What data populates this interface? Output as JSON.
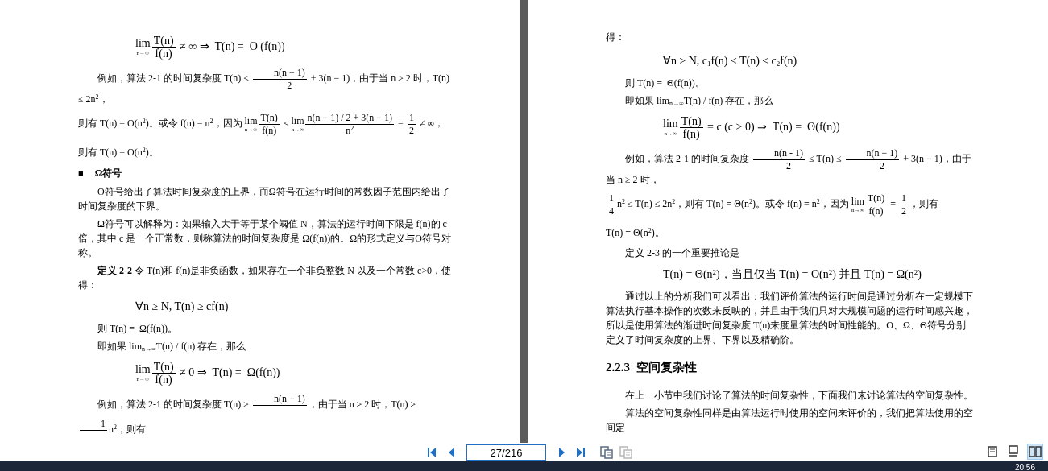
{
  "pages": [
    {
      "blocks": [
        {
          "kind": "display",
          "segments": [
            {
              "kind": "lim",
              "sub": "n→∞"
            },
            {
              "kind": "frac",
              "num": "T(n)",
              "den": "f(n)"
            },
            {
              "kind": "text",
              "text": " ≠ ∞ ⇒  T(n) =  Ο (f(n))"
            }
          ]
        },
        {
          "kind": "para",
          "segments": [
            {
              "kind": "text",
              "text": "例如，算法 2-1 的时间复杂度 T(n) ≤ "
            },
            {
              "kind": "frac",
              "num": "n(n − 1)",
              "den": "2"
            },
            {
              "kind": "text",
              "text": " + 3(n − 1)，由于当 n ≥ 2 时，T(n) ≤ 2n$^{2}$，"
            }
          ]
        },
        {
          "kind": "text",
          "segments": [
            {
              "kind": "text",
              "text": "则有 T(n) = O(n$^{2}$)。或令 f(n) = n$^{2}$，因为 "
            },
            {
              "kind": "lim",
              "sub": "n→∞"
            },
            {
              "kind": "frac",
              "num": "T(n)",
              "den": "f(n)"
            },
            {
              "kind": "text",
              "text": " ≤ "
            },
            {
              "kind": "lim",
              "sub": "n→∞"
            },
            {
              "kind": "frac",
              "num": "n(n − 1) / 2 + 3(n − 1)",
              "den": "n$^{2}$"
            },
            {
              "kind": "text",
              "text": " = "
            },
            {
              "kind": "frac",
              "num": "1",
              "den": "2"
            },
            {
              "kind": "text",
              "text": " ≠ ∞，"
            }
          ]
        },
        {
          "kind": "text",
          "segments": [
            {
              "kind": "text",
              "text": "则有 T(n) = O(n$^{2}$)。"
            }
          ]
        },
        {
          "kind": "heading",
          "bullet": "■",
          "title": "Ω符号"
        },
        {
          "kind": "para",
          "segments": [
            {
              "kind": "text",
              "text": "Ο符号给出了算法时间复杂度的上界，而Ω符号在运行时间的常数因子范围内给出了时间复杂度的下界。"
            }
          ]
        },
        {
          "kind": "para",
          "segments": [
            {
              "kind": "text",
              "text": "Ω符号可以解释为：如果输入大于等于某个阈值 N，算法的运行时间下限是 f(n)的 c 倍，其中 c 是一个正常数，则称算法的时间复杂度是 Ω(f(n))的。Ω的形式定义与Ο符号对称。"
            }
          ]
        },
        {
          "kind": "para",
          "segments": [
            {
              "kind": "text",
              "text": "**定义 2-2** 令 T(n)和 f(n)是非负函数，如果存在一个非负整数 N 以及一个常数 c>0，使得："
            }
          ]
        },
        {
          "kind": "display",
          "segments": [
            {
              "kind": "text",
              "text": "∀n ≥ N, T(n) ≥ cf(n)"
            }
          ]
        },
        {
          "kind": "para",
          "segments": [
            {
              "kind": "text",
              "text": "则 T(n) =  Ω(f(n))。"
            }
          ]
        },
        {
          "kind": "para",
          "segments": [
            {
              "kind": "text",
              "text": "即如果 lim$_{n→∞}$T(n) / f(n) 存在，那么"
            }
          ]
        },
        {
          "kind": "display",
          "segments": [
            {
              "kind": "lim",
              "sub": "n→∞"
            },
            {
              "kind": "frac",
              "num": "T(n)",
              "den": "f(n)"
            },
            {
              "kind": "text",
              "text": " ≠ 0 ⇒  T(n) =  Ω(f(n))"
            }
          ]
        },
        {
          "kind": "para",
          "segments": [
            {
              "kind": "text",
              "text": "例如，算法 2-1 的时间复杂度 T(n) ≥ "
            },
            {
              "kind": "frac",
              "num": "n(n − 1)"
            },
            {
              "kind": "text",
              "text": "，由于当 n ≥ 2 时，T(n) ≥ "
            },
            {
              "kind": "frac",
              "num": "1"
            },
            {
              "kind": "text",
              "text": "n$^{2}$，则有"
            }
          ]
        }
      ]
    },
    {
      "blocks": [
        {
          "kind": "text",
          "segments": [
            {
              "kind": "text",
              "text": "得："
            }
          ]
        },
        {
          "kind": "display",
          "segments": [
            {
              "kind": "text",
              "text": "∀n ≥ N, c$_{1}$f(n) ≤ T(n) ≤ c$_{2}$f(n)"
            }
          ]
        },
        {
          "kind": "para",
          "segments": [
            {
              "kind": "text",
              "text": "则 T(n) =  Θ(f(n))。"
            }
          ]
        },
        {
          "kind": "para",
          "segments": [
            {
              "kind": "text",
              "text": "即如果 lim$_{n→∞}$T(n) / f(n) 存在，那么"
            }
          ]
        },
        {
          "kind": "display",
          "segments": [
            {
              "kind": "lim",
              "sub": "n→∞"
            },
            {
              "kind": "frac",
              "num": "T(n)",
              "den": "f(n)"
            },
            {
              "kind": "text",
              "text": " = c (c > 0) ⇒  T(n) =  Θ(f(n))"
            }
          ]
        },
        {
          "kind": "para",
          "segments": [
            {
              "kind": "text",
              "text": "例如，算法 2-1 的时间复杂度 "
            },
            {
              "kind": "frac",
              "num": "n(n - 1)",
              "den": "2"
            },
            {
              "kind": "text",
              "text": " ≤ T(n) ≤ "
            },
            {
              "kind": "frac",
              "num": "n(n − 1)",
              "den": "2"
            },
            {
              "kind": "text",
              "text": " + 3(n − 1)，由于当 n ≥ 2 时，"
            }
          ]
        },
        {
          "kind": "text",
          "segments": [
            {
              "kind": "frac",
              "num": "1",
              "den": "4"
            },
            {
              "kind": "text",
              "text": "n$^{2}$ ≤ T(n) ≤ 2n$^{2}$，则有 T(n) = Θ(n$^{2}$)。或令 f(n) = n$^{2}$，因为 "
            },
            {
              "kind": "lim",
              "sub": "n→∞"
            },
            {
              "kind": "frac",
              "num": "T(n)",
              "den": "f(n)"
            },
            {
              "kind": "text",
              "text": " = "
            },
            {
              "kind": "frac",
              "num": "1",
              "den": "2"
            },
            {
              "kind": "text",
              "text": "，则有"
            }
          ]
        },
        {
          "kind": "text",
          "segments": [
            {
              "kind": "text",
              "text": "T(n) = Θ(n$^{2}$)。"
            }
          ]
        },
        {
          "kind": "para",
          "segments": [
            {
              "kind": "text",
              "text": "定义 2-3 的一个重要推论是"
            }
          ]
        },
        {
          "kind": "display",
          "segments": [
            {
              "kind": "text",
              "text": "T(n) = Θ(n$^{2}$)，当且仅当 T(n) = O(n$^{2}$) 并且 T(n) = Ω(n$^{2}$)"
            }
          ]
        },
        {
          "kind": "para",
          "segments": [
            {
              "kind": "text",
              "text": "通过以上的分析我们可以看出：我们评价算法的运行时间是通过分析在一定规模下算法执行基本操作的次数来反映的，并且由于我们只对大规模问题的运行时间感兴趣，所以是使用算法的渐进时间复杂度 T(n)来度量算法的时间性能的。Ο、Ω、Θ符号分别定义了时间复杂度的上界、下界以及精确阶。"
            }
          ]
        },
        {
          "kind": "section",
          "title": "2.2.3  空间复杂性"
        },
        {
          "kind": "para",
          "segments": [
            {
              "kind": "text",
              "text": "在上一小节中我们讨论了算法的时间复杂性，下面我们来讨论算法的空间复杂性。"
            }
          ]
        },
        {
          "kind": "para",
          "segments": [
            {
              "kind": "text",
              "text": "算法的空间复杂性同样是由算法运行时使用的空间来评价的，我们把算法使用的空间定"
            }
          ]
        }
      ]
    }
  ],
  "toolbar": {
    "page": "27/216",
    "actions": [
      {
        "disabled": false
      },
      {
        "disabled": true
      }
    ],
    "views": [
      {
        "selected": false
      },
      {
        "selected": false
      },
      {
        "selected": true
      }
    ]
  },
  "taskbar": {
    "clock": "20:56"
  }
}
